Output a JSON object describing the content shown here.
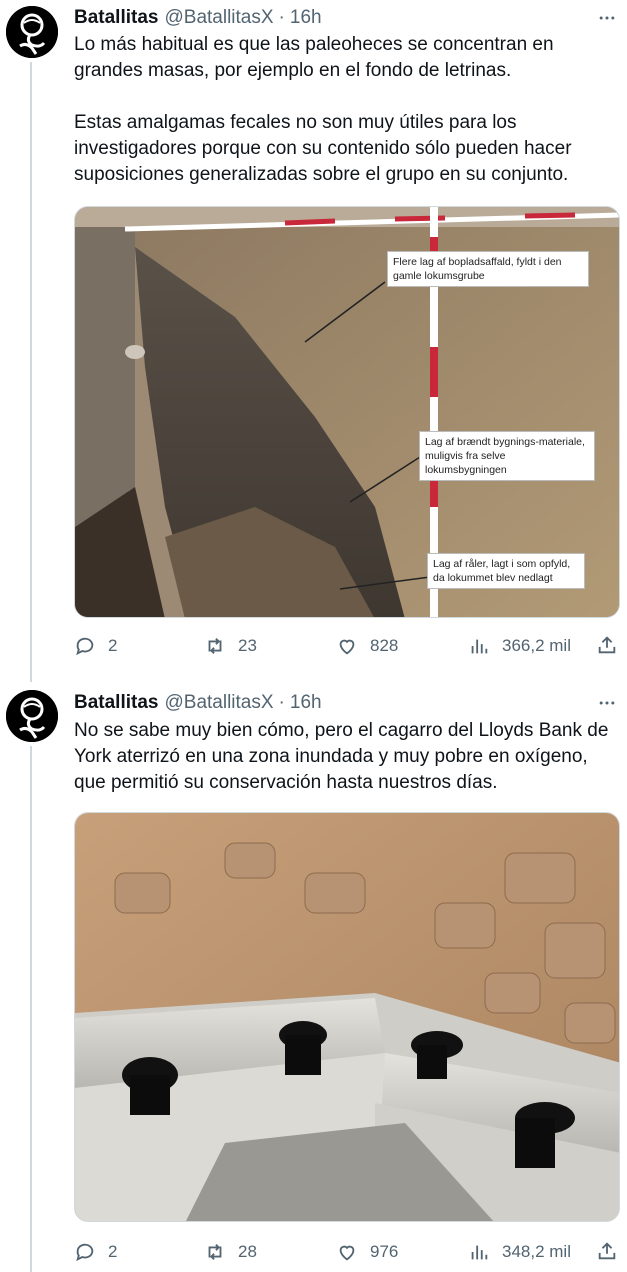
{
  "tweets": [
    {
      "author": {
        "name": "Batallitas",
        "handle": "@BatallitasX"
      },
      "separator": "·",
      "time": "16h",
      "text": "Lo más habitual es que las paleoheces se concentran en grandes masas, por ejemplo en el fondo de letrinas.\n\nEstas amalgamas fecales no son muy útiles para los investigadores porque con su contenido sólo pueden hacer suposiciones generalizadas sobre el grupo en su conjunto.",
      "image_annotations": [
        "Flere lag af bopladsaffald, fyldt i den gamle lokumsgrube",
        "Lag af brændt bygnings-materiale, muligvis fra selve lokumsbygningen",
        "Lag af råler, lagt i som opfyld, da lokummet blev nedlagt"
      ],
      "stats": {
        "replies": "2",
        "reposts": "23",
        "likes": "828",
        "views": "366,2 mil"
      }
    },
    {
      "author": {
        "name": "Batallitas",
        "handle": "@BatallitasX"
      },
      "separator": "·",
      "time": "16h",
      "text": "No se sabe muy bien cómo, pero el cagarro del Lloyds Bank de York aterrizó en una zona inundada y muy pobre en oxígeno, que permitió su conservación hasta nuestros días.",
      "stats": {
        "replies": "2",
        "reposts": "28",
        "likes": "976",
        "views": "348,2 mil"
      }
    }
  ],
  "icons": {
    "more": "more-dots-icon",
    "reply": "reply-bubble-icon",
    "repost": "repost-arrows-icon",
    "like": "heart-icon",
    "views": "views-bar-chart-icon",
    "share": "share-upload-icon"
  }
}
